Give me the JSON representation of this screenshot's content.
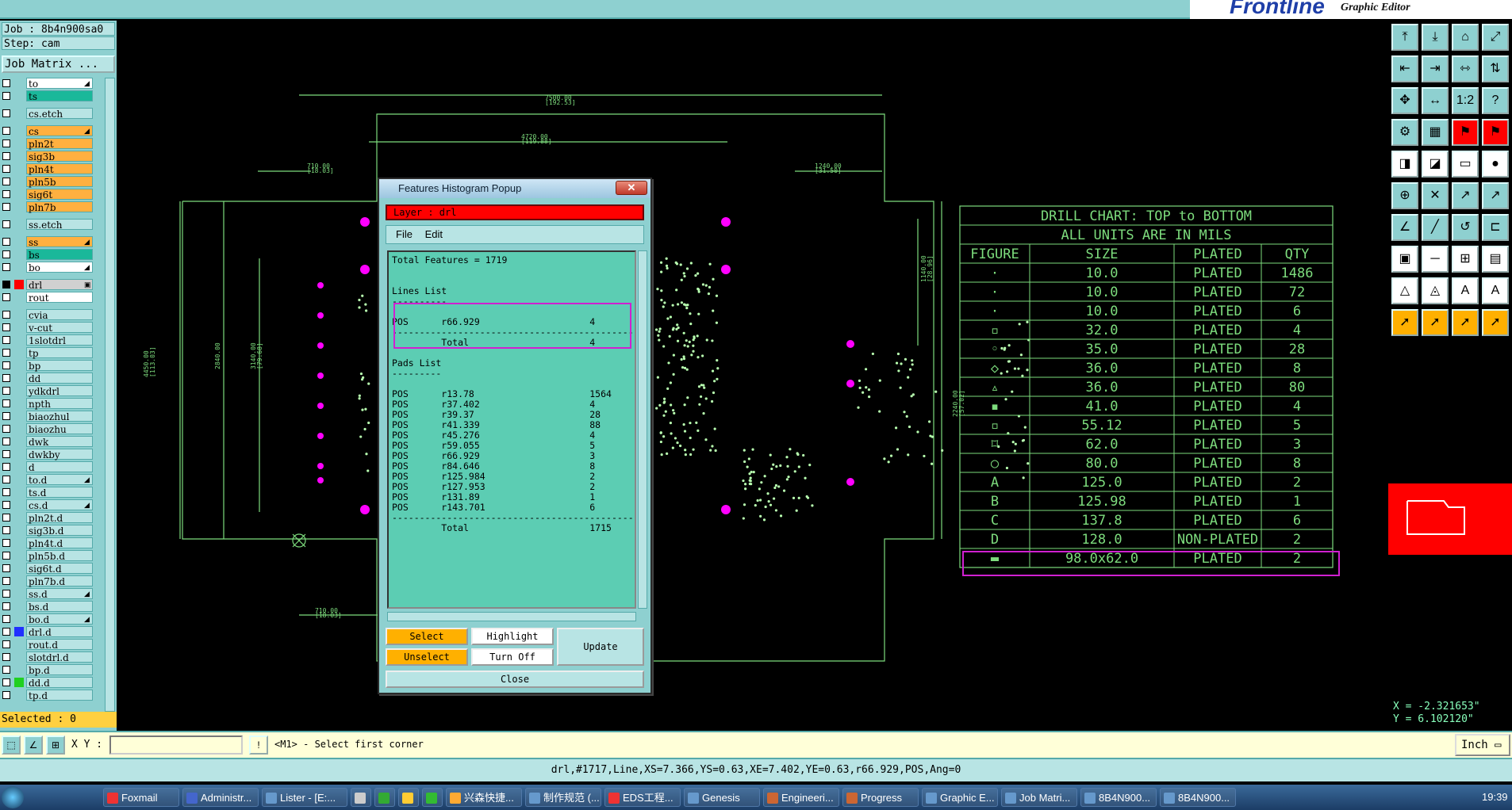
{
  "window": {
    "title_fragment": "",
    "brand": "Frontline",
    "app_name": "Graphic Editor"
  },
  "job": {
    "job_label": "Job : 8b4n900sa0",
    "step_label": "Step: cam",
    "matrix_button": "Job Matrix ...",
    "selected": "Selected : 0"
  },
  "layers": [
    {
      "name": "to",
      "color": "#ffffff",
      "mark": "◢"
    },
    {
      "name": "ts",
      "color": "#1ab89a",
      "mark": ""
    },
    {
      "name": "cs.etch",
      "color": "#b8e4e4",
      "mark": ""
    },
    {
      "name": "cs",
      "color": "#ffb040",
      "mark": "◢"
    },
    {
      "name": "pln2t",
      "color": "#ffb040",
      "mark": ""
    },
    {
      "name": "sig3b",
      "color": "#ffb040",
      "mark": ""
    },
    {
      "name": "pln4t",
      "color": "#ffb040",
      "mark": ""
    },
    {
      "name": "pln5b",
      "color": "#ffb040",
      "mark": ""
    },
    {
      "name": "sig6t",
      "color": "#ffb040",
      "mark": ""
    },
    {
      "name": "pln7b",
      "color": "#ffb040",
      "mark": ""
    },
    {
      "name": "ss.etch",
      "color": "#b8e4e4",
      "mark": ""
    },
    {
      "name": "ss",
      "color": "#ffb040",
      "mark": "◢"
    },
    {
      "name": "bs",
      "color": "#1ab89a",
      "mark": ""
    },
    {
      "name": "bo",
      "color": "#ffffff",
      "mark": "◢"
    },
    {
      "name": "drl",
      "color": "#d0d0d0",
      "mark": "▣"
    },
    {
      "name": "rout",
      "color": "#ffffff",
      "mark": ""
    },
    {
      "name": "cvia",
      "color": "#b8e4e4",
      "mark": ""
    },
    {
      "name": "v-cut",
      "color": "#b8e4e4",
      "mark": ""
    },
    {
      "name": "1slotdrl",
      "color": "#b8e4e4",
      "mark": ""
    },
    {
      "name": "tp",
      "color": "#b8e4e4",
      "mark": ""
    },
    {
      "name": "bp",
      "color": "#b8e4e4",
      "mark": ""
    },
    {
      "name": "dd",
      "color": "#b8e4e4",
      "mark": ""
    },
    {
      "name": "ydkdrl",
      "color": "#b8e4e4",
      "mark": ""
    },
    {
      "name": "npth",
      "color": "#b8e4e4",
      "mark": ""
    },
    {
      "name": "biaozhul",
      "color": "#b8e4e4",
      "mark": ""
    },
    {
      "name": "biaozhu",
      "color": "#b8e4e4",
      "mark": ""
    },
    {
      "name": "dwk",
      "color": "#b8e4e4",
      "mark": ""
    },
    {
      "name": "dwkby",
      "color": "#b8e4e4",
      "mark": ""
    },
    {
      "name": "d",
      "color": "#b8e4e4",
      "mark": ""
    },
    {
      "name": "to.d",
      "color": "#b8e4e4",
      "mark": "◢"
    },
    {
      "name": "ts.d",
      "color": "#b8e4e4",
      "mark": ""
    },
    {
      "name": "cs.d",
      "color": "#b8e4e4",
      "mark": "◢"
    },
    {
      "name": "pln2t.d",
      "color": "#b8e4e4",
      "mark": ""
    },
    {
      "name": "sig3b.d",
      "color": "#b8e4e4",
      "mark": ""
    },
    {
      "name": "pln4t.d",
      "color": "#b8e4e4",
      "mark": ""
    },
    {
      "name": "pln5b.d",
      "color": "#b8e4e4",
      "mark": ""
    },
    {
      "name": "sig6t.d",
      "color": "#b8e4e4",
      "mark": ""
    },
    {
      "name": "pln7b.d",
      "color": "#b8e4e4",
      "mark": ""
    },
    {
      "name": "ss.d",
      "color": "#b8e4e4",
      "mark": "◢"
    },
    {
      "name": "bs.d",
      "color": "#b8e4e4",
      "mark": ""
    },
    {
      "name": "bo.d",
      "color": "#b8e4e4",
      "mark": "◢"
    },
    {
      "name": "drl.d",
      "color": "#b8e4e4",
      "mark": ""
    },
    {
      "name": "rout.d",
      "color": "#b8e4e4",
      "mark": ""
    },
    {
      "name": "slotdrl.d",
      "color": "#b8e4e4",
      "mark": ""
    },
    {
      "name": "bp.d",
      "color": "#b8e4e4",
      "mark": ""
    },
    {
      "name": "dd.d",
      "color": "#b8e4e4",
      "mark": ""
    },
    {
      "name": "tp.d",
      "color": "#b8e4e4",
      "mark": ""
    }
  ],
  "popup": {
    "title": "Features Histogram Popup",
    "layer": "Layer :  drl",
    "menu_file": "File",
    "menu_edit": "Edit",
    "text": "Total Features = 1719\n\n\nLines List\n----------\n\nPOS      r66.929                    4\n-----------------------------------------------\n         Total                      4\n\nPads List\n---------\n\nPOS      r13.78                     1564\nPOS      r37.402                    4\nPOS      r39.37                     28\nPOS      r41.339                    88\nPOS      r45.276                    4\nPOS      r59.055                    5\nPOS      r66.929                    3\nPOS      r84.646                    8\nPOS      r125.984                   2\nPOS      r127.953                   2\nPOS      r131.89                    1\nPOS      r143.701                   6\n-----------------------------------------------\n         Total                      1715",
    "btn_select": "Select",
    "btn_unselect": "Unselect",
    "btn_highlight": "Highlight",
    "btn_turnoff": "Turn Off",
    "btn_update": "Update",
    "btn_close": "Close"
  },
  "drill_chart": {
    "title": "DRILL CHART: TOP to BOTTOM",
    "subtitle": "ALL UNITS ARE IN MILS",
    "headers": [
      "FIGURE",
      "SIZE",
      "PLATED",
      "QTY"
    ],
    "rows": [
      [
        "·",
        "10.0",
        "PLATED",
        "1486"
      ],
      [
        "·",
        "10.0",
        "PLATED",
        "72"
      ],
      [
        "·",
        "10.0",
        "PLATED",
        "6"
      ],
      [
        "▫",
        "32.0",
        "PLATED",
        "4"
      ],
      [
        "◦",
        "35.0",
        "PLATED",
        "28"
      ],
      [
        "◇",
        "36.0",
        "PLATED",
        "8"
      ],
      [
        "▵",
        "36.0",
        "PLATED",
        "80"
      ],
      [
        "▪",
        "41.0",
        "PLATED",
        "4"
      ],
      [
        "▫",
        "55.12",
        "PLATED",
        "5"
      ],
      [
        "⌑",
        "62.0",
        "PLATED",
        "3"
      ],
      [
        "○",
        "80.0",
        "PLATED",
        "8"
      ],
      [
        "A",
        "125.0",
        "PLATED",
        "2"
      ],
      [
        "B",
        "125.98",
        "PLATED",
        "1"
      ],
      [
        "C",
        "137.8",
        "PLATED",
        "6"
      ],
      [
        "D",
        "128.0",
        "NON-PLATED",
        "2"
      ],
      [
        "▬",
        "98.0x62.0",
        "PLATED",
        "2"
      ]
    ]
  },
  "dimensions": [
    "7500.00",
    "[192.53]",
    "4720.00",
    "[119.88]",
    "710.00",
    "[18.03]",
    "1240.00",
    "[31.50]",
    "4450.00",
    "[113.03]",
    "2840.00",
    "3140.00",
    "[79.68]",
    "2240.00",
    "[57.02]",
    "1140.00",
    "[28.96]",
    "710.00",
    "[18.03]"
  ],
  "coords": {
    "x": "X = -2.321653\"",
    "y": "Y = 6.102120\""
  },
  "command": {
    "xy_label": "X Y :",
    "xy_value": "",
    "prompt": "<M1> - Select first corner",
    "units": "Inch"
  },
  "status": "drl,#1717,Line,XS=7.366,YS=0.63,XE=7.402,YE=0.63,r66.929,POS,Ang=0",
  "taskbar": {
    "items": [
      "Foxmail",
      "Administr...",
      "Lister - [E:...",
      "",
      "",
      "",
      "",
      "兴森快捷...",
      "制作规范 (...",
      "EDS工程...",
      "Genesis",
      "Engineeri...",
      "Progress",
      "Graphic E...",
      "Job Matri...",
      "8B4N900...",
      "8B4N900..."
    ],
    "clock": "19:39"
  },
  "toolbar_glyphs": [
    "⤒",
    "⤓",
    "⌂",
    "⤢",
    "⇤",
    "⇥",
    "⇿",
    "⇅",
    "✥",
    "↔",
    "1:2",
    "?",
    "⚙",
    "▦",
    "⚑",
    "⚑",
    "◨",
    "◪",
    "▭",
    "●",
    "⊕",
    "✕",
    "↗",
    "↗",
    "∠",
    "╱",
    "↺",
    "⊏",
    "▣",
    "─",
    "⊞",
    "▤",
    "△",
    "◬",
    "A",
    "A",
    "➚",
    "➚",
    "➚",
    "➚"
  ],
  "colors": {
    "panel": "#8ed0d0",
    "cad_green": "#7ddc7d",
    "magenta": "#d020d0",
    "pad": "#ff00ff"
  }
}
